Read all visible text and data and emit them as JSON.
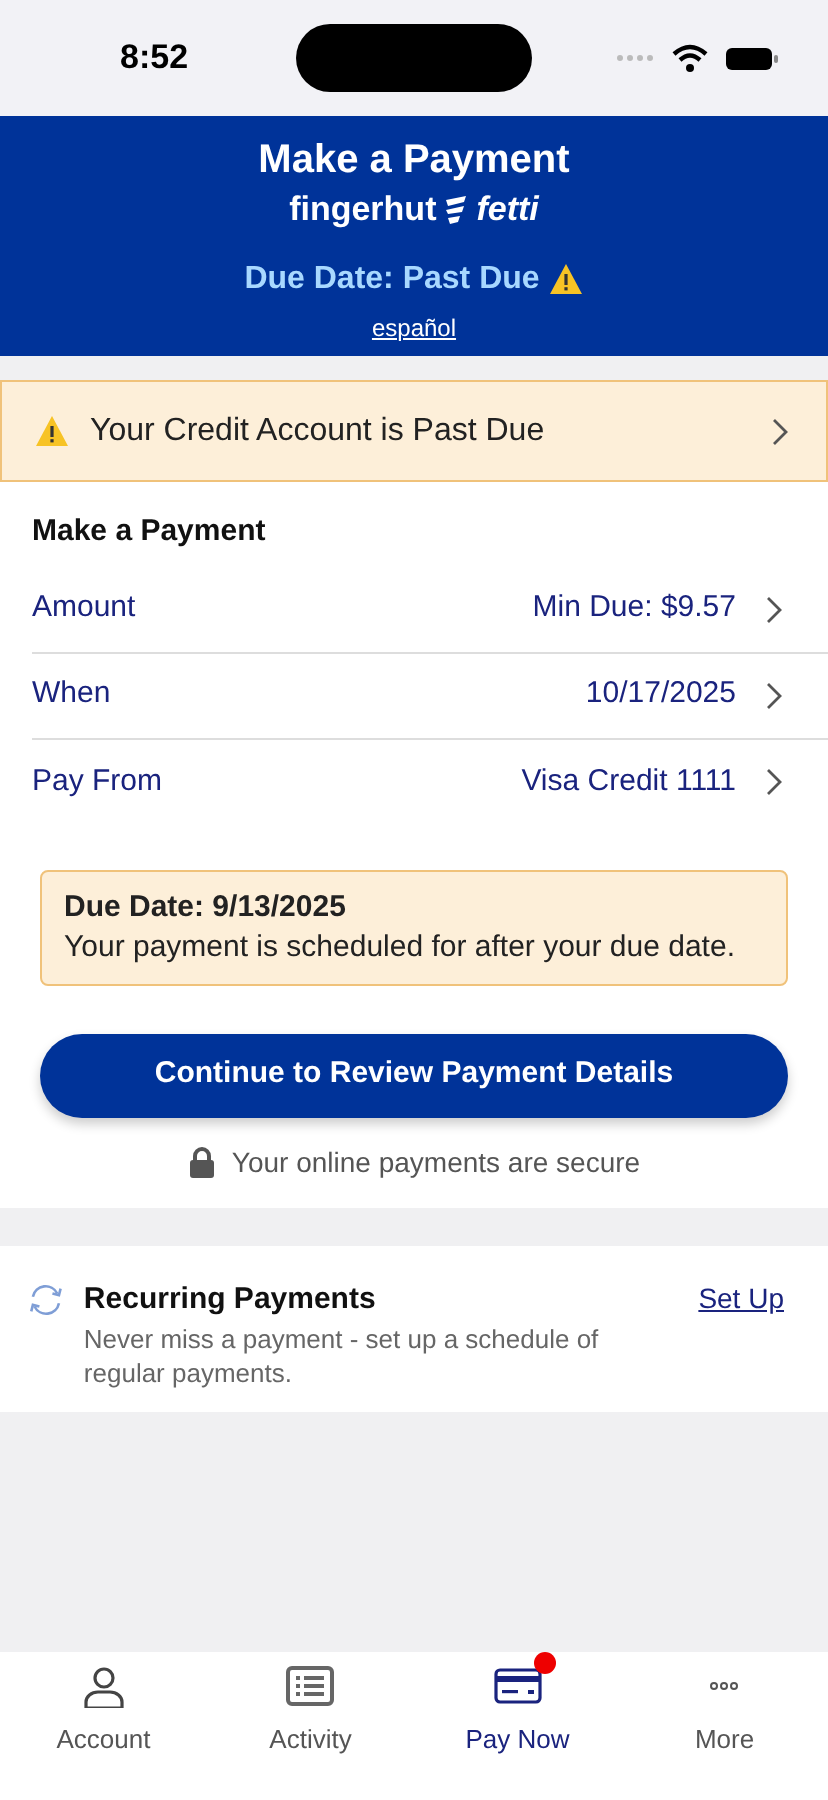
{
  "status_bar": {
    "time": "8:52"
  },
  "header": {
    "title": "Make a Payment",
    "logo_left": "fingerhut",
    "logo_right": "fetti",
    "due_label": "Due Date: Past Due",
    "language_link": "español"
  },
  "alert": {
    "text": "Your Credit Account is Past Due"
  },
  "section_title": "Make a Payment",
  "rows": [
    {
      "label": "Amount",
      "value": "Min Due: $9.57"
    },
    {
      "label": "When",
      "value": "10/17/2025"
    },
    {
      "label": "Pay From",
      "value": "Visa Credit 1111"
    }
  ],
  "notice": {
    "title": "Due Date: 9/13/2025",
    "text": "Your payment is scheduled for after your due date."
  },
  "continue_button": "Continue to Review Payment Details",
  "secure_note": "Your online payments are secure",
  "recurring": {
    "title": "Recurring Payments",
    "text": "Never miss a payment - set up a schedule of regular payments.",
    "link": "Set Up"
  },
  "tabs": [
    {
      "label": "Account",
      "selected": false,
      "badge": false
    },
    {
      "label": "Activity",
      "selected": false,
      "badge": false
    },
    {
      "label": "Pay Now",
      "selected": true,
      "badge": true
    },
    {
      "label": "More",
      "selected": false,
      "badge": false
    }
  ]
}
